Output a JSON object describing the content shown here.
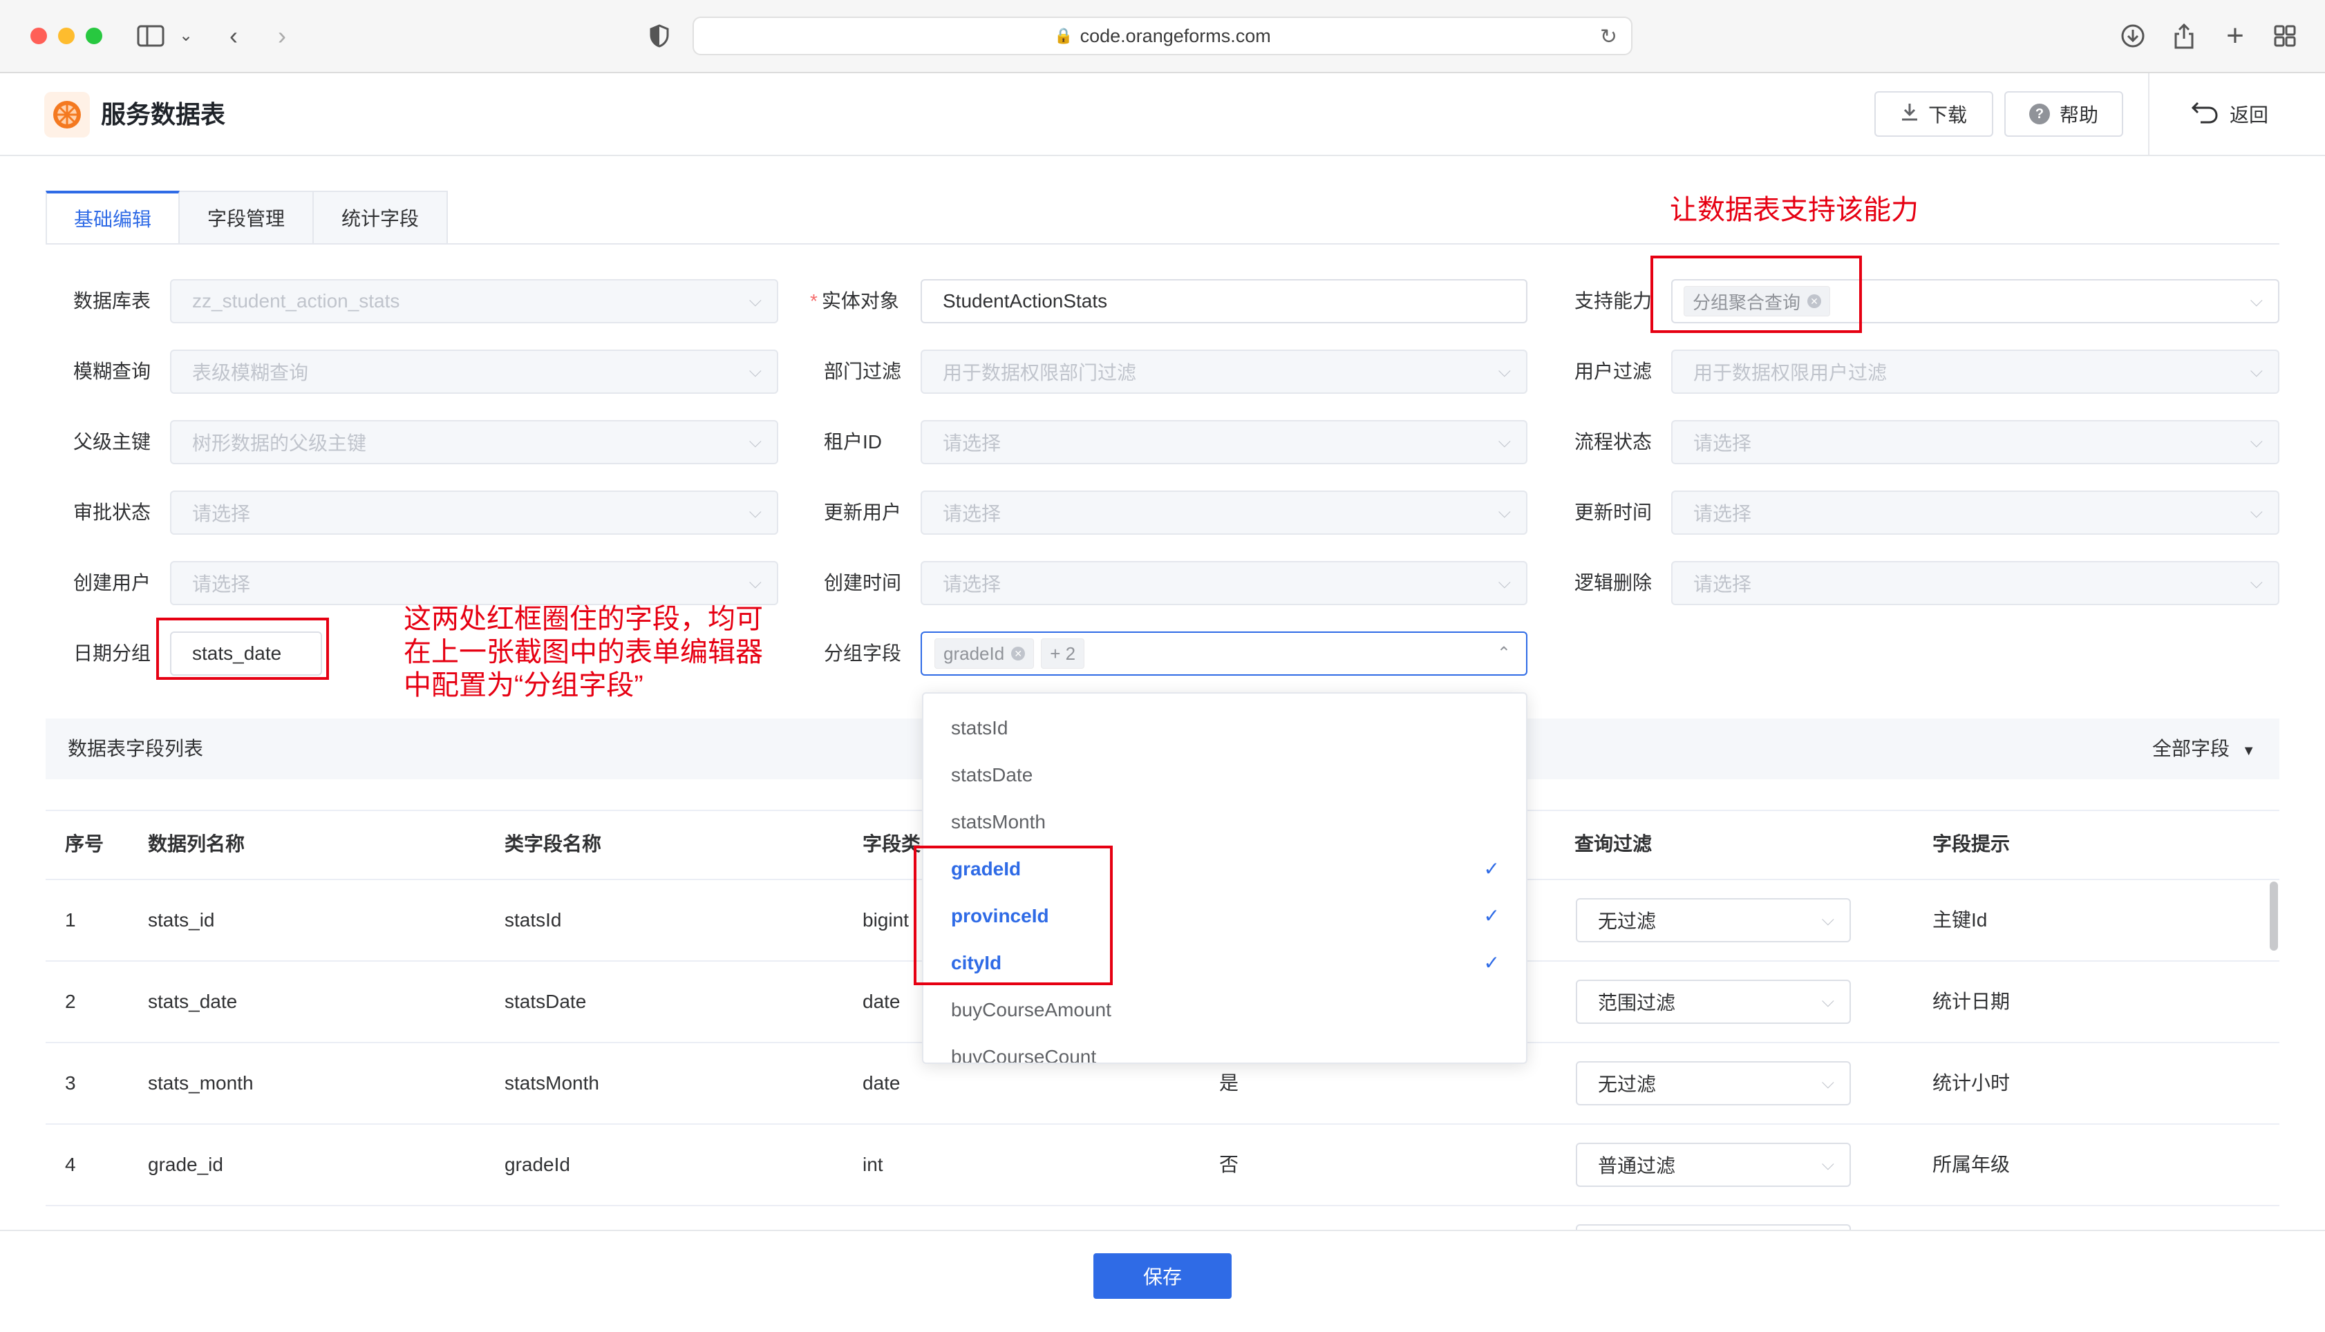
{
  "browser": {
    "url": "code.orangeforms.com"
  },
  "header": {
    "title": "服务数据表",
    "download_label": "下载",
    "help_label": "帮助",
    "back_label": "返回"
  },
  "tabs": [
    {
      "label": "基础编辑",
      "active": true
    },
    {
      "label": "字段管理",
      "active": false
    },
    {
      "label": "统计字段",
      "active": false
    }
  ],
  "annotations": {
    "top": "让数据表支持该能力",
    "mid_line1": "这两处红框圈住的字段，均可",
    "mid_line2": "在上一张截图中的表单编辑器",
    "mid_line3": "中配置为“分组字段”"
  },
  "form": {
    "database_table": {
      "label": "数据库表",
      "value": "zz_student_action_stats"
    },
    "entity": {
      "label": "实体对象",
      "value": "StudentActionStats",
      "required": true
    },
    "capability": {
      "label": "支持能力",
      "tag": "分组聚合查询"
    },
    "fuzzy_query": {
      "label": "模糊查询",
      "placeholder": "表级模糊查询"
    },
    "dept_filter": {
      "label": "部门过滤",
      "placeholder": "用于数据权限部门过滤"
    },
    "user_filter": {
      "label": "用户过滤",
      "placeholder": "用于数据权限用户过滤"
    },
    "parent_key": {
      "label": "父级主键",
      "placeholder": "树形数据的父级主键"
    },
    "tenant_id": {
      "label": "租户ID",
      "placeholder": "请选择"
    },
    "flow_status": {
      "label": "流程状态",
      "placeholder": "请选择"
    },
    "approval_status": {
      "label": "审批状态",
      "placeholder": "请选择"
    },
    "update_user": {
      "label": "更新用户",
      "placeholder": "请选择"
    },
    "update_time": {
      "label": "更新时间",
      "placeholder": "请选择"
    },
    "create_user": {
      "label": "创建用户",
      "placeholder": "请选择"
    },
    "create_time": {
      "label": "创建时间",
      "placeholder": "请选择"
    },
    "logic_delete": {
      "label": "逻辑删除",
      "placeholder": "请选择"
    },
    "date_group": {
      "label": "日期分组",
      "value": "stats_date"
    },
    "group_fields": {
      "label": "分组字段",
      "tag": "gradeId",
      "more": "+ 2"
    }
  },
  "dropdown": {
    "items": [
      {
        "label": "statsId",
        "selected": false
      },
      {
        "label": "statsDate",
        "selected": false
      },
      {
        "label": "statsMonth",
        "selected": false
      },
      {
        "label": "gradeId",
        "selected": true
      },
      {
        "label": "provinceId",
        "selected": true
      },
      {
        "label": "cityId",
        "selected": true
      },
      {
        "label": "buyCourseAmount",
        "selected": false
      },
      {
        "label": "buyCourseCount",
        "selected": false
      }
    ]
  },
  "section": {
    "title": "数据表字段列表",
    "all_fields": "全部字段"
  },
  "table": {
    "columns": [
      "序号",
      "数据列名称",
      "类字段名称",
      "字段类",
      "查询过滤",
      "字段提示"
    ],
    "rows": [
      {
        "index": "1",
        "column": "stats_id",
        "field": "statsId",
        "type": "bigint",
        "flag": "",
        "filter": "无过滤",
        "hint": "主键Id"
      },
      {
        "index": "2",
        "column": "stats_date",
        "field": "statsDate",
        "type": "date",
        "flag": "",
        "filter": "范围过滤",
        "hint": "统计日期"
      },
      {
        "index": "3",
        "column": "stats_month",
        "field": "statsMonth",
        "type": "date",
        "flag": "是",
        "filter": "无过滤",
        "hint": "统计小时"
      },
      {
        "index": "4",
        "column": "grade_id",
        "field": "gradeId",
        "type": "int",
        "flag": "否",
        "filter": "普通过滤",
        "hint": "所属年级"
      }
    ]
  },
  "footer": {
    "save_label": "保存"
  },
  "colors": {
    "primary": "#2f6be6",
    "annotation_red": "#e60012"
  }
}
